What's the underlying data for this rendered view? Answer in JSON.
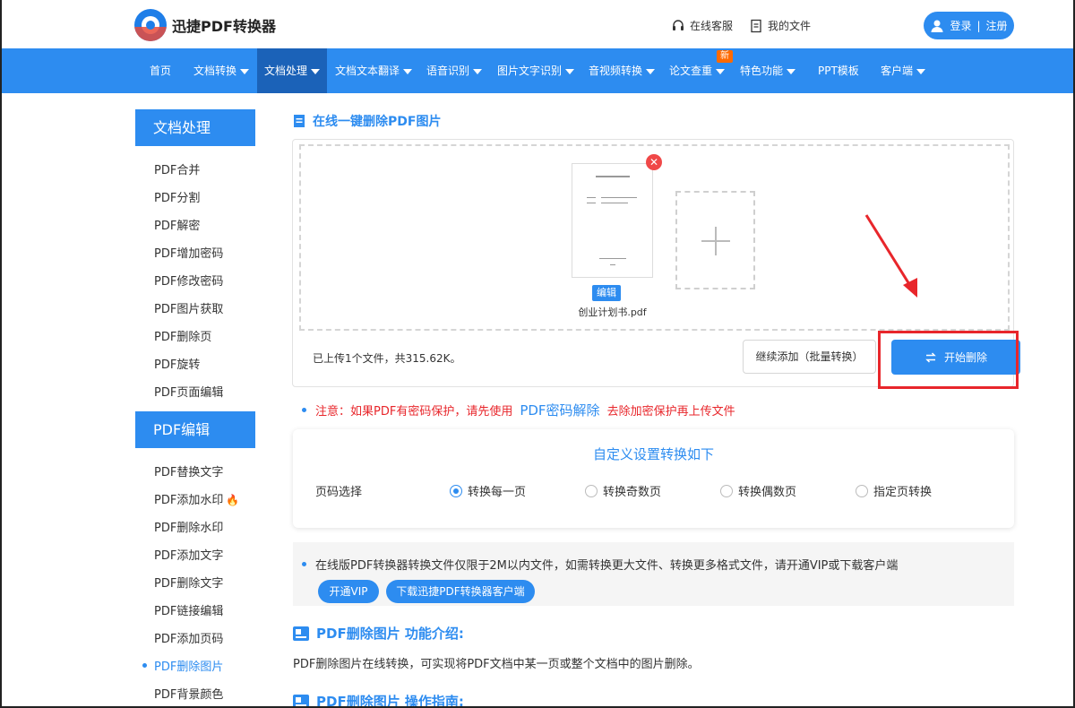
{
  "header": {
    "logo_text": "迅捷PDF转换器",
    "online_service": "在线客服",
    "my_files": "我的文件",
    "login": "登录",
    "register": "注册"
  },
  "nav": {
    "items": [
      {
        "label": "首页",
        "dropdown": false
      },
      {
        "label": "文档转换",
        "dropdown": true
      },
      {
        "label": "文档处理",
        "dropdown": true,
        "active": true
      },
      {
        "label": "文档文本翻译",
        "dropdown": true
      },
      {
        "label": "语音识别",
        "dropdown": true
      },
      {
        "label": "图片文字识别",
        "dropdown": true
      },
      {
        "label": "音视频转换",
        "dropdown": true
      },
      {
        "label": "论文查重",
        "dropdown": true
      },
      {
        "label": "特色功能",
        "dropdown": true
      },
      {
        "label": "PPT模板",
        "dropdown": false
      },
      {
        "label": "客户端",
        "dropdown": true
      }
    ],
    "new_badge": "新"
  },
  "sidebar": {
    "group1_title": "文档处理",
    "group1_items": [
      "PDF合并",
      "PDF分割",
      "PDF解密",
      "PDF增加密码",
      "PDF修改密码",
      "PDF图片获取",
      "PDF删除页",
      "PDF旋转",
      "PDF页面编辑"
    ],
    "group2_title": "PDF编辑",
    "group2_items": [
      "PDF替换文字",
      "PDF添加水印",
      "PDF删除水印",
      "PDF添加文字",
      "PDF删除文字",
      "PDF链接编辑",
      "PDF添加页码",
      "PDF删除图片",
      "PDF背景颜色"
    ],
    "current": "PDF删除图片"
  },
  "main": {
    "title": "在线一键删除PDF图片",
    "file": {
      "name": "创业计划书.pdf",
      "edit_label": "编辑"
    },
    "status": "已上传1个文件，共315.62K。",
    "continue_button": "继续添加（批量转换）",
    "start_button": "开始删除",
    "notice": {
      "part1": "注意：如果PDF有密码保护，请先使用",
      "link": "PDF密码解除",
      "part2": "去除加密保护再上传文件"
    },
    "settings": {
      "title": "自定义设置转换如下",
      "label": "页码选择",
      "options": [
        "转换每一页",
        "转换奇数页",
        "转换偶数页",
        "指定页转换"
      ],
      "selected": "转换每一页"
    },
    "limit": {
      "text": "在线版PDF转换器转换文件仅限于2M以内文件，如需转换更大文件、转换更多格式文件，请开通VIP或下载客户端",
      "vip_button": "开通VIP",
      "download_button": "下载迅捷PDF转换器客户端"
    },
    "intro": {
      "title": "PDF删除图片 功能介绍:",
      "text": "PDF删除图片在线转换，可实现将PDF文档中某一页或整个文档中的图片删除。",
      "guide_title": "PDF删除图片 操作指南:"
    }
  },
  "colors": {
    "brand_blue": "#2d8cf0",
    "nav_active": "#1b62b8",
    "highlight_red": "#e8262b",
    "badge_orange": "#ff6a00"
  }
}
